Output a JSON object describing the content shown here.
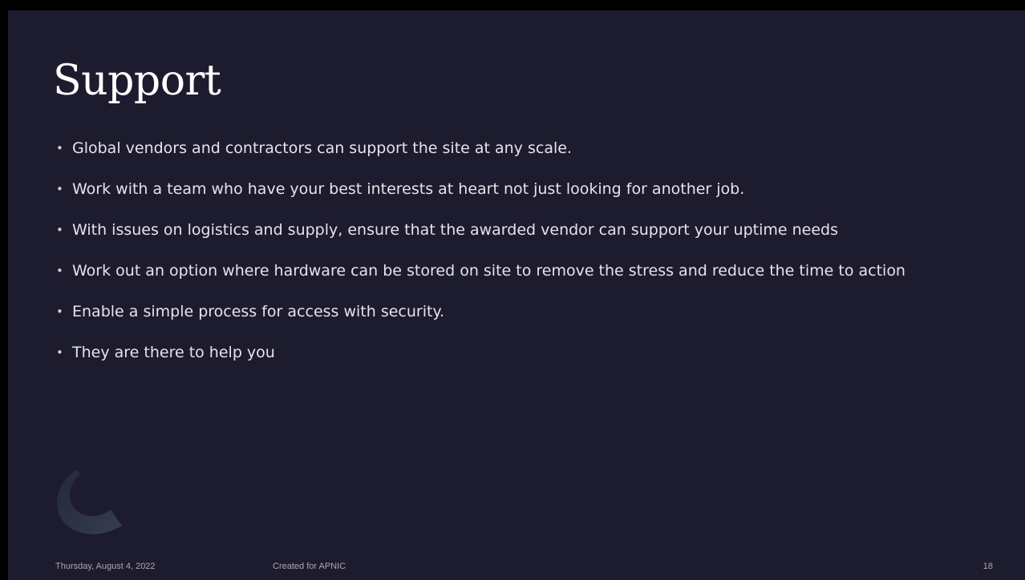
{
  "slide": {
    "title": "Support",
    "bullets": [
      {
        "text": "Global vendors and contractors can support the site at any scale."
      },
      {
        "text": "Work with a team who have your best interests at heart not just looking for another job."
      },
      {
        "text": "With issues on logistics and supply, ensure that the awarded vendor can support your uptime needs"
      },
      {
        "text": "Work out an option where hardware can be stored on site to remove the stress and reduce the time to action"
      },
      {
        "text": "Enable a simple process for access with security."
      },
      {
        "text": "They are there to help you"
      }
    ],
    "bullet_glyph": "•",
    "footer": {
      "date": "Thursday, August 4, 2022",
      "center": "Created for APNIC",
      "page_number": "18"
    }
  },
  "colors": {
    "background": "#1d1b2e",
    "title": "#ffffff",
    "body_text": "#e4e4ea",
    "footer_text": "#a9a8b6",
    "arc_decoration": "#2c3344"
  },
  "icons": [
    "arc-decoration-icon"
  ]
}
